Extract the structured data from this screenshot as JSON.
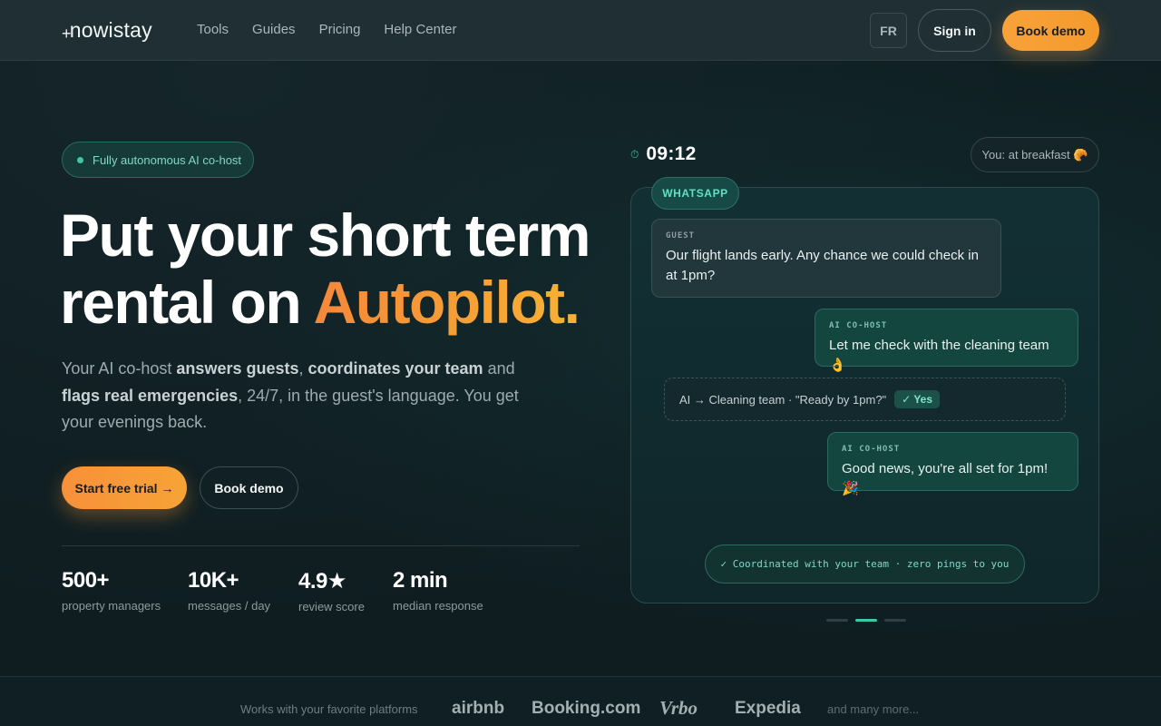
{
  "nav": {
    "logo": "nowistay",
    "links": [
      "Tools",
      "Guides",
      "Pricing",
      "Help Center"
    ],
    "lang": "FR",
    "sign_in": "Sign in",
    "book_demo": "Book demo"
  },
  "hero": {
    "pill": "Fully autonomous AI co-host",
    "headline_line1": "Put your short term",
    "headline_line2_prefix": "rental on ",
    "headline_accent": "Autopilot.",
    "sub": {
      "p1": "Your AI co-host ",
      "b1": "answers guests",
      "p2": ", ",
      "b2": "coordinates your team",
      "p3": " and ",
      "b3": "flags real emergencies",
      "p4": ", 24/7, in the guest's language. You get your evenings back."
    },
    "cta_primary": "Start free trial →",
    "cta_secondary": "Book demo",
    "stats": [
      {
        "value": "500+",
        "label": "property managers"
      },
      {
        "value": "10K+",
        "label": "messages / day"
      },
      {
        "value": "4.9★",
        "label": "review score"
      },
      {
        "value": "2 min",
        "label": "median response"
      }
    ]
  },
  "chat": {
    "time": "09:12",
    "status": "You: at breakfast 🥐",
    "channel": "WHATSAPP",
    "messages": [
      {
        "role": "GUEST",
        "text": "Our flight lands early. Any chance we could check in at 1pm?"
      },
      {
        "role": "AI CO-HOST",
        "text": "Let me check with the cleaning team 👌"
      },
      {
        "role": "AI CO-HOST",
        "text": "Good news, you're all set for 1pm! 🎉"
      }
    ],
    "coordination": "AI → Cleaning team · \"Ready by 1pm?\"",
    "coordination_reply": "✓ Yes",
    "footer": "✓ Coordinated with your team · zero pings to you"
  },
  "platforms": {
    "label": "Works with your favorite platforms",
    "names": [
      "airbnb",
      "Booking.com",
      "Vrbo",
      "Expedia"
    ],
    "more": "and many more..."
  }
}
